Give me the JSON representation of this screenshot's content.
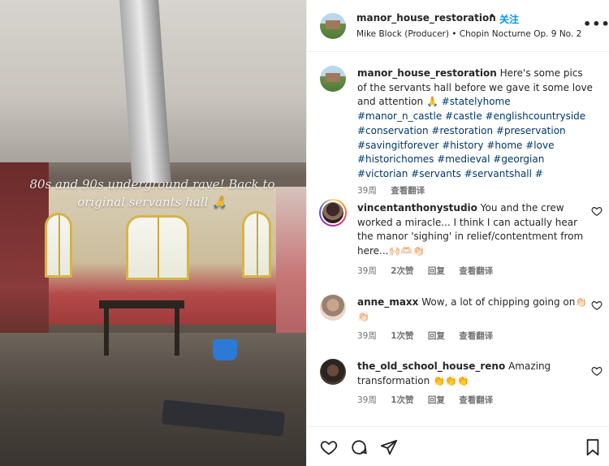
{
  "photo": {
    "overlay_text": "80s and 90s underground rave! Back to original servants hall 🙏"
  },
  "header": {
    "username": "manor_house_restoration",
    "separator": "•",
    "follow_label": "关注",
    "audio": "Mike Block (Producer) • Chopin Nocturne Op. 9 No. 2",
    "more_icon": "more-horizontal-icon"
  },
  "caption": {
    "username": "manor_house_restoration",
    "text": "Here's some pics of the servants hall before we gave it some love and attention 🙏",
    "hashtags": "#statelyhome #manor_n_castle #castle #englishcountryside #conservation #restoration #preservation #savingitforever #history #home #love #historichomes #medieval #georgian #victorian #servants #servantshall #",
    "time": "39周",
    "translate": "查看翻译"
  },
  "comments": [
    {
      "username": "vincentanthonystudio",
      "text": "You and the crew worked a miracle... I think I can actually hear the manor 'sighing' in relief/contentment from here...🙌🏻🫶🏻👏🏻",
      "time": "39周",
      "likes": "2次赞",
      "reply": "回复",
      "translate": "查看翻译"
    },
    {
      "username": "anne_maxx",
      "text": "Wow, a lot of chipping going on👏🏻👏🏻",
      "time": "39周",
      "likes": "1次赞",
      "reply": "回复",
      "translate": "查看翻译"
    },
    {
      "username": "the_old_school_house_reno",
      "text": "Amazing transformation 👏👏👏",
      "time": "39周",
      "likes": "1次赞",
      "reply": "回复",
      "translate": "查看翻译"
    }
  ],
  "actions": {
    "like_icon": "heart-icon",
    "comment_icon": "comment-icon",
    "share_icon": "share-icon",
    "save_icon": "bookmark-icon"
  },
  "colors": {
    "accent": "#0095f6",
    "hashtag": "#00376b",
    "meta": "#737373"
  }
}
